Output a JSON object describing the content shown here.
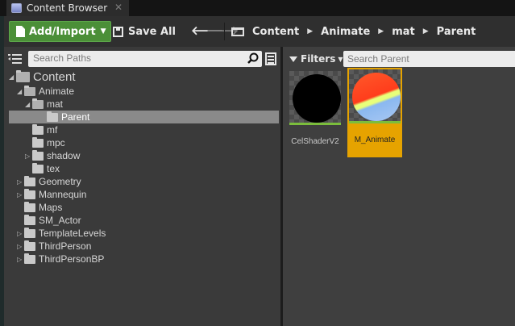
{
  "tab": {
    "title": "Content Browser",
    "close": "✕"
  },
  "toolbar": {
    "add_import_label": "Add/Import",
    "save_all_label": "Save All",
    "breadcrumbs": [
      "Content",
      "Animate",
      "mat",
      "Parent"
    ]
  },
  "sources": {
    "search_placeholder": "Search Paths",
    "tree": [
      {
        "label": "Content",
        "depth": 0,
        "expander": "open",
        "open": true
      },
      {
        "label": "Animate",
        "depth": 1,
        "expander": "open",
        "open": true
      },
      {
        "label": "mat",
        "depth": 2,
        "expander": "open",
        "open": true
      },
      {
        "label": "Parent",
        "depth": 3,
        "expander": "none",
        "selected": true
      },
      {
        "label": "mf",
        "depth": 2,
        "expander": "none"
      },
      {
        "label": "mpc",
        "depth": 2,
        "expander": "none"
      },
      {
        "label": "shadow",
        "depth": 2,
        "expander": "closed"
      },
      {
        "label": "tex",
        "depth": 2,
        "expander": "none"
      },
      {
        "label": "Geometry",
        "depth": 1,
        "expander": "closed"
      },
      {
        "label": "Mannequin",
        "depth": 1,
        "expander": "closed"
      },
      {
        "label": "Maps",
        "depth": 1,
        "expander": "none"
      },
      {
        "label": "SM_Actor",
        "depth": 1,
        "expander": "none"
      },
      {
        "label": "TemplateLevels",
        "depth": 1,
        "expander": "closed"
      },
      {
        "label": "ThirdPerson",
        "depth": 1,
        "expander": "closed"
      },
      {
        "label": "ThirdPersonBP",
        "depth": 1,
        "expander": "closed"
      }
    ]
  },
  "assets": {
    "filters_label": "Filters",
    "search_placeholder": "Search Parent",
    "items": [
      {
        "label": "CelShaderV2",
        "selected": false,
        "thumbnail": "black-sphere"
      },
      {
        "label": "M_Animate",
        "selected": true,
        "thumbnail": "orange-yellow-blue-sphere"
      }
    ]
  },
  "colors": {
    "add_button": "#4b8f38",
    "selection": "#e6a300",
    "asset_bar": "#7bbd3c"
  }
}
